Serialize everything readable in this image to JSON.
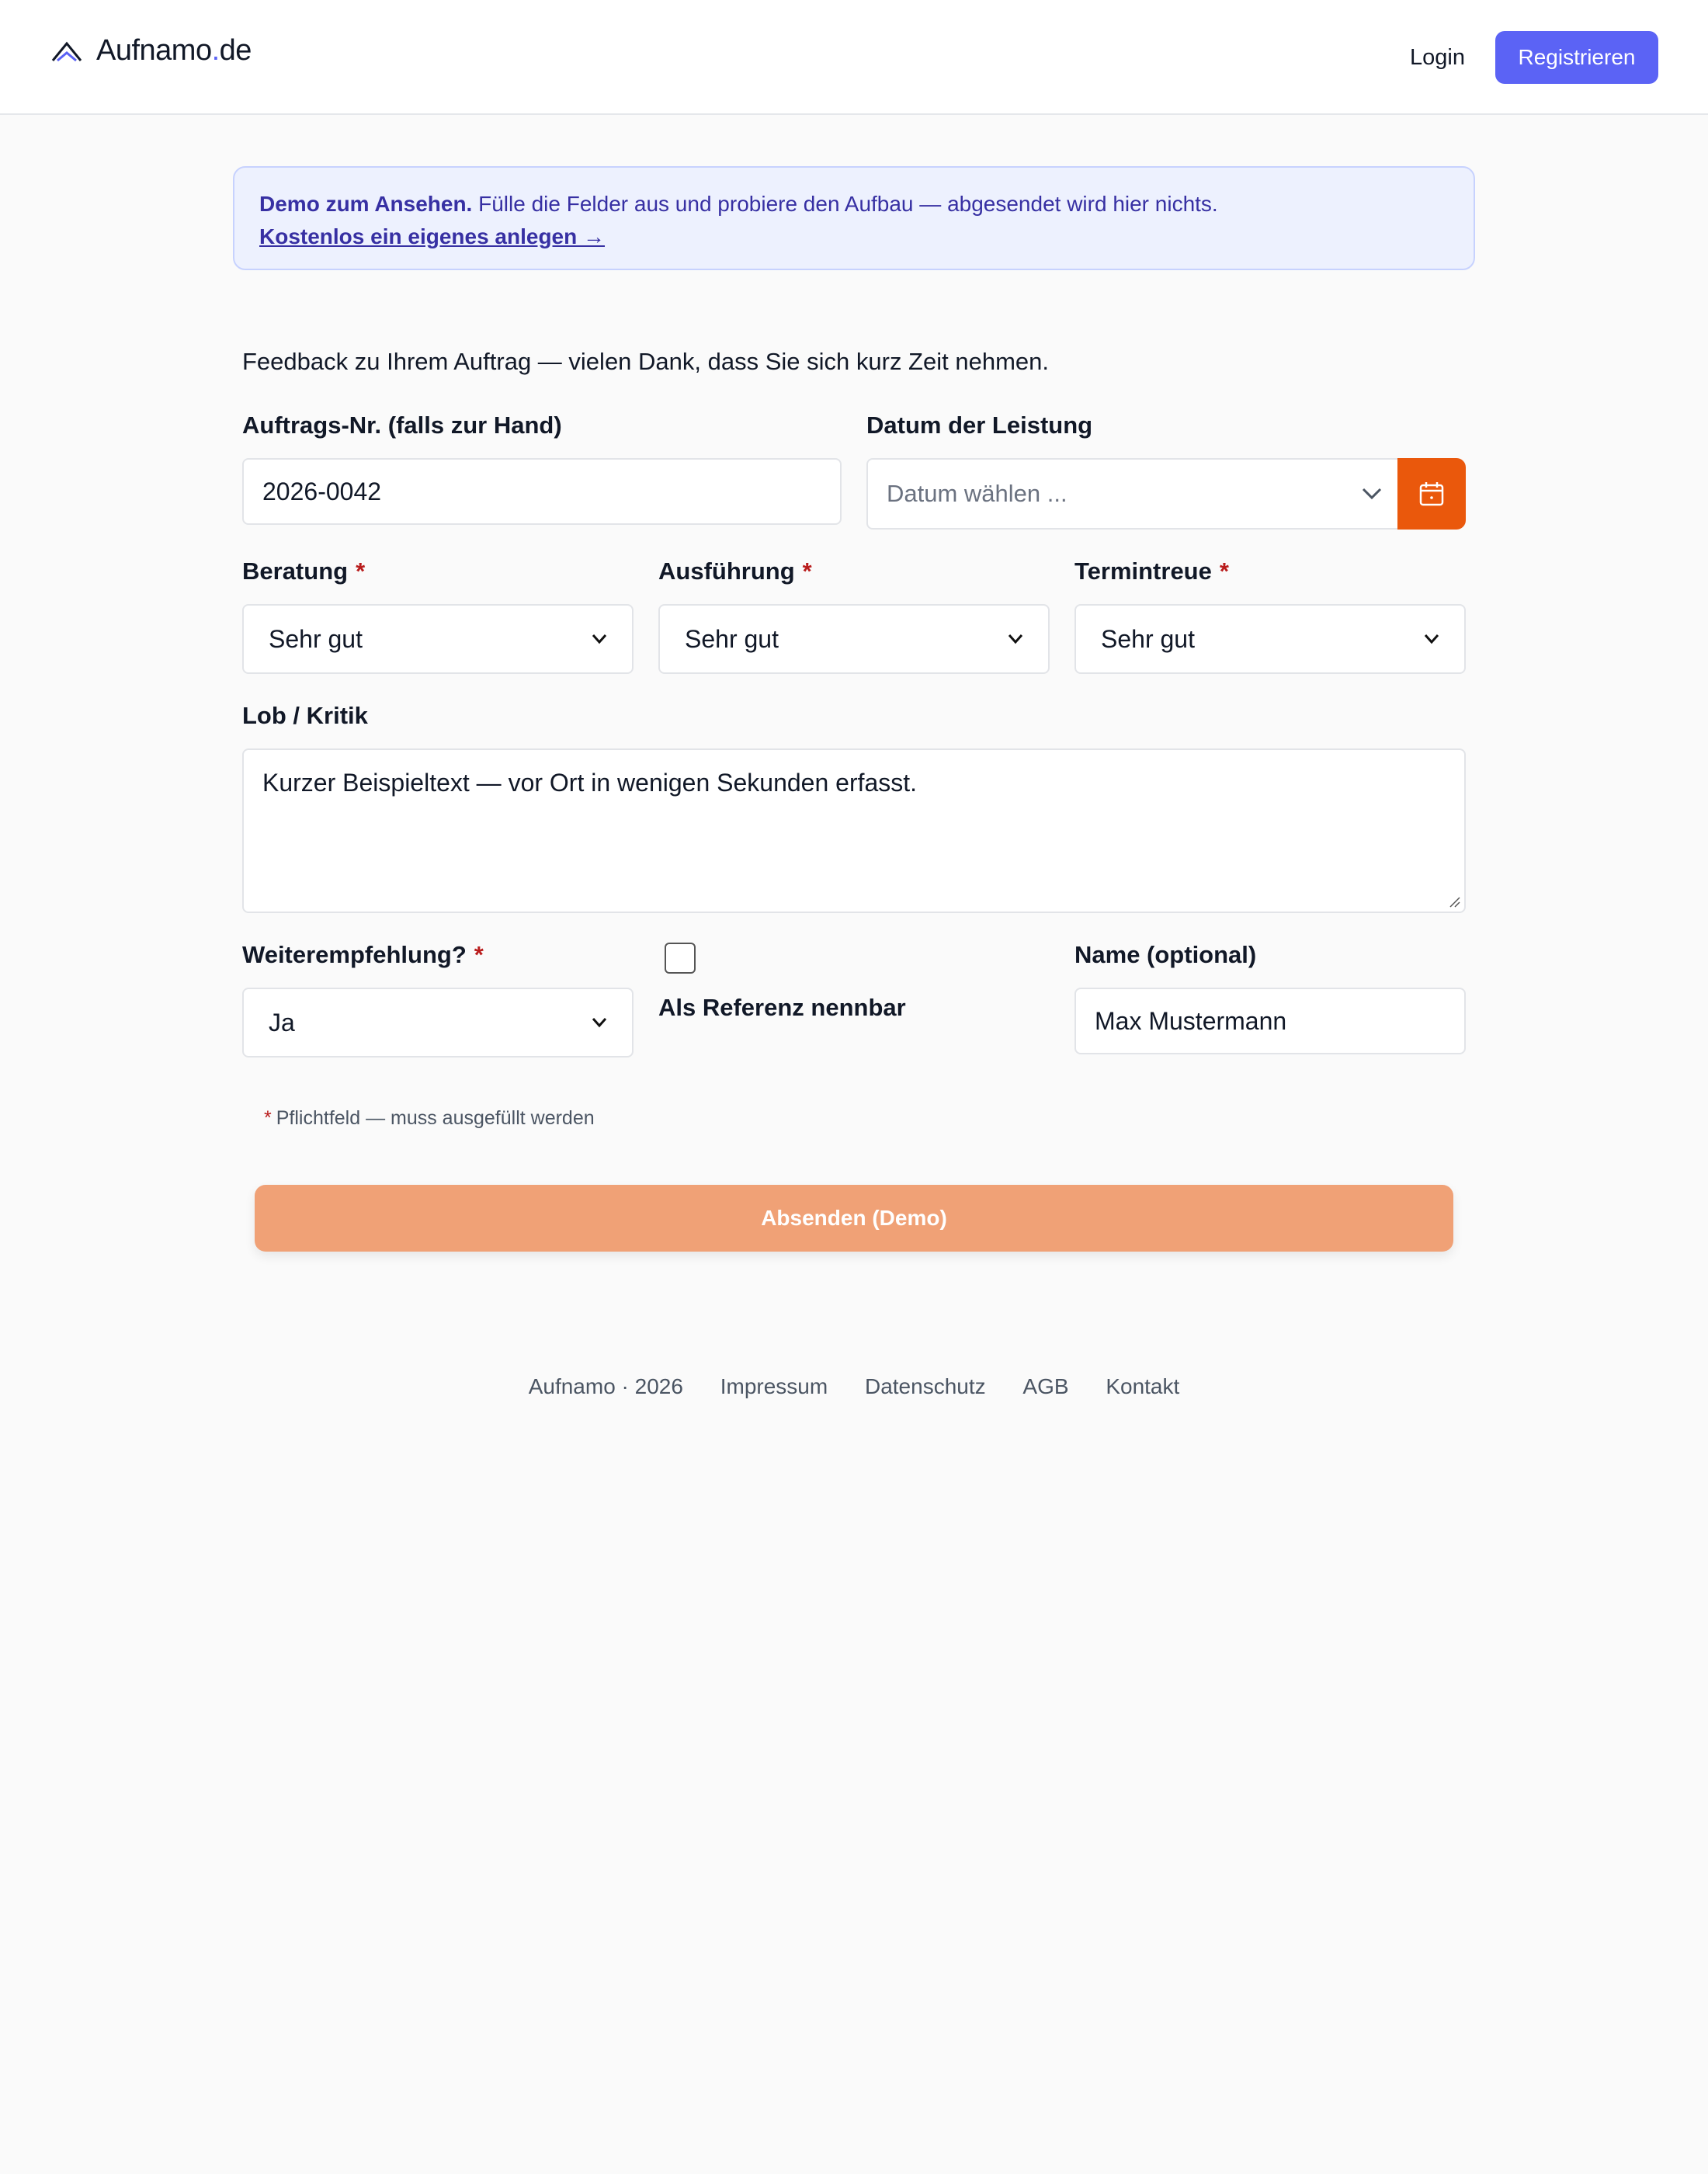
{
  "header": {
    "brand_name": "Aufnamo",
    "brand_dot": ".",
    "brand_tld": "de",
    "login_label": "Login",
    "register_label": "Registrieren"
  },
  "banner": {
    "strong": "Demo zum Ansehen.",
    "text": " Fülle die Felder aus und probiere den Aufbau — abgesendet wird hier nichts.",
    "link": "Kostenlos ein eigenes anlegen →"
  },
  "form": {
    "intro": "Feedback zu Ihrem Auftrag — vielen Dank, dass Sie sich kurz Zeit nehmen.",
    "order_no": {
      "label": "Auftrags-Nr. (falls zur Hand)",
      "value": "2026-0042"
    },
    "date": {
      "label": "Datum der Leistung",
      "placeholder": "Datum wählen ..."
    },
    "beratung": {
      "label": "Beratung",
      "value": "Sehr gut"
    },
    "ausfuehrung": {
      "label": "Ausführung",
      "value": "Sehr gut"
    },
    "termintreue": {
      "label": "Termintreue",
      "value": "Sehr gut"
    },
    "lob_kritik": {
      "label": "Lob / Kritik",
      "value": "Kurzer Beispieltext — vor Ort in wenigen Sekunden erfasst."
    },
    "weiterempfehlung": {
      "label": "Weiterempfehlung?",
      "value": "Ja"
    },
    "referenz": {
      "label": "Als Referenz nennbar"
    },
    "name": {
      "label": "Name (optional)",
      "value": "Max Mustermann"
    },
    "required_mark": "*",
    "hint": "Pflichtfeld — muss ausgefüllt werden",
    "submit_label": "Absenden (Demo)"
  },
  "footer": {
    "copyright": "Aufnamo · 2026",
    "links": [
      "Impressum",
      "Datenschutz",
      "AGB",
      "Kontakt"
    ]
  },
  "colors": {
    "accent": "#5b63f5",
    "orange": "#ea580c",
    "submit": "#f0a176",
    "banner_bg": "#edf1fe",
    "required": "#b91c1c"
  }
}
